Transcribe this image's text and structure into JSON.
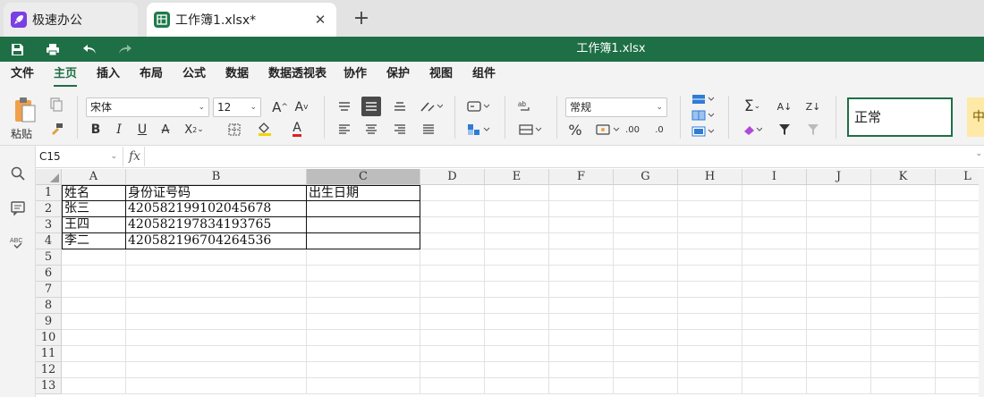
{
  "tabs": [
    {
      "label": "极速办公",
      "active": false
    },
    {
      "label": "工作簿1.xlsx*",
      "active": true
    }
  ],
  "title": "工作簿1.xlsx",
  "menu": [
    "文件",
    "主页",
    "插入",
    "布局",
    "公式",
    "数据",
    "数据透视表",
    "协作",
    "保护",
    "视图",
    "组件"
  ],
  "active_menu": "主页",
  "ribbon": {
    "paste_label": "粘贴",
    "font_name": "宋体",
    "font_size": "12",
    "number_format": "常规",
    "style_normal": "正常",
    "style_medium": "中"
  },
  "formula_bar": {
    "cell_ref": "C15",
    "fx": "fx",
    "value": ""
  },
  "sheet": {
    "columns": [
      "A",
      "B",
      "C",
      "D",
      "E",
      "F",
      "G",
      "H",
      "I",
      "J",
      "K",
      "L"
    ],
    "selected_column": "C",
    "row_numbers": [
      "1",
      "2",
      "3",
      "4",
      "5",
      "6",
      "7",
      "8",
      "9",
      "10",
      "11",
      "12",
      "13"
    ],
    "rows": [
      [
        "姓名",
        "身份证号码",
        "出生日期"
      ],
      [
        "张三",
        "420582199102045678",
        ""
      ],
      [
        "王四",
        "420582197834193765",
        ""
      ],
      [
        "李二",
        "420582196704264536",
        ""
      ]
    ]
  }
}
